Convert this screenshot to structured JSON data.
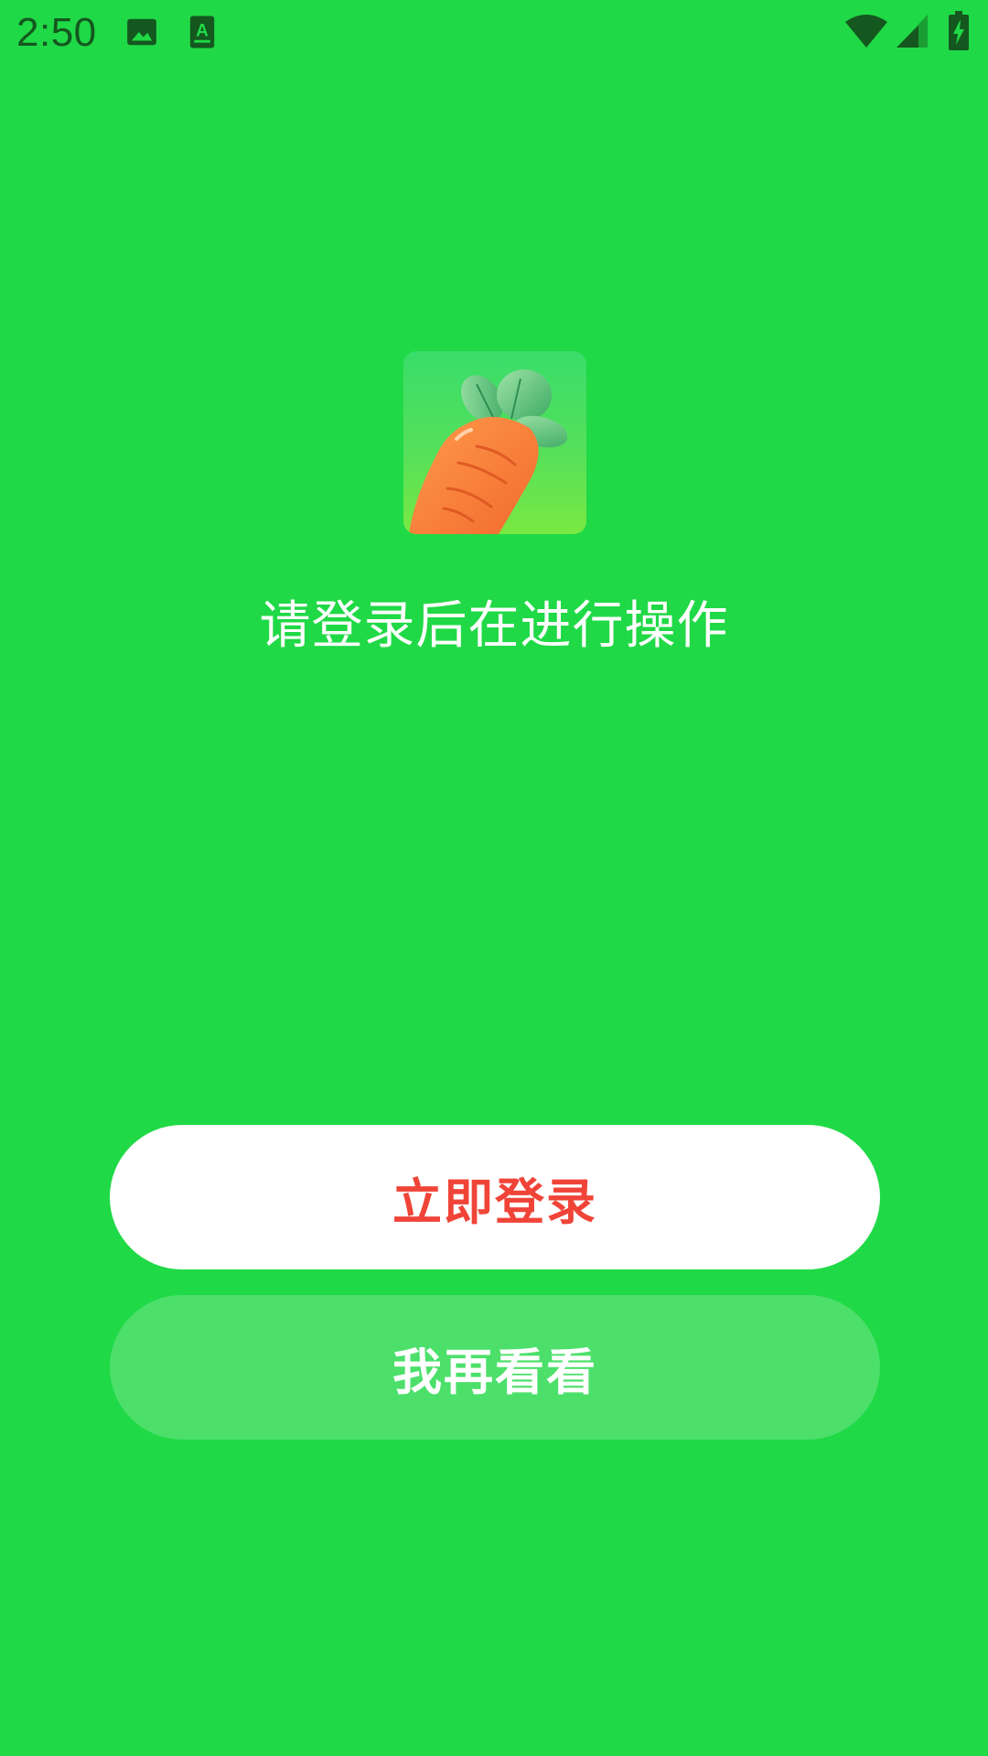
{
  "status_bar": {
    "time": "2:50",
    "icons": [
      "image-icon",
      "text-recognition-icon",
      "wifi-icon",
      "cell-signal-icon",
      "battery-charging-icon"
    ]
  },
  "app": {
    "icon": "carrot-icon"
  },
  "message": "请登录后在进行操作",
  "buttons": {
    "login_label": "立即登录",
    "later_label": "我再看看"
  },
  "colors": {
    "background": "#20D946",
    "login_text": "#F04438",
    "login_bg": "#FFFFFF",
    "later_bg": "#4CE06B",
    "later_text": "#FFFFFF"
  }
}
